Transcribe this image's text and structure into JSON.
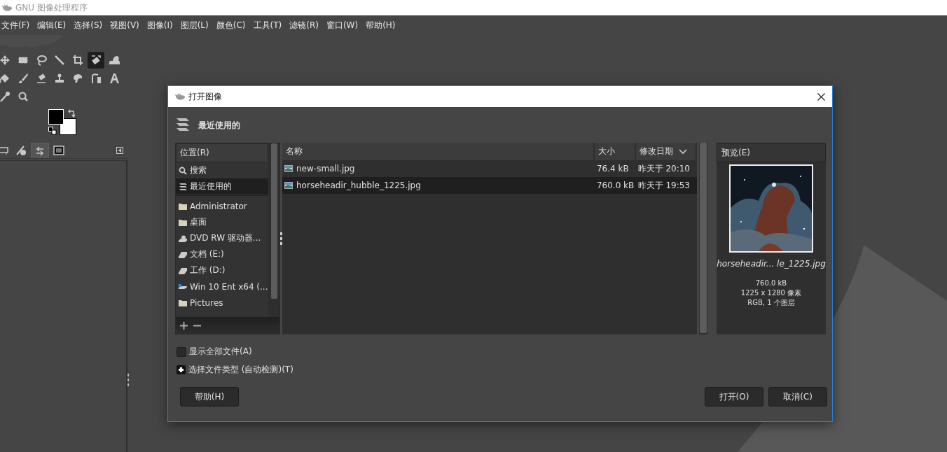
{
  "app": {
    "title": "GNU 图像处理程序"
  },
  "menu": [
    "文件(F)",
    "编辑(E)",
    "选择(S)",
    "视图(V)",
    "图像(I)",
    "图层(L)",
    "颜色(C)",
    "工具(T)",
    "滤镜(R)",
    "窗口(W)",
    "帮助(H)"
  ],
  "tools": [
    {
      "kind": "move",
      "selected": false
    },
    {
      "kind": "rect",
      "selected": false
    },
    {
      "kind": "lasso",
      "selected": false
    },
    {
      "kind": "wand",
      "selected": false
    },
    {
      "kind": "crop",
      "selected": false
    },
    {
      "kind": "transform",
      "selected": true
    },
    {
      "kind": "warp",
      "selected": false
    },
    {
      "kind": "bucket",
      "selected": false
    },
    {
      "kind": "brush",
      "selected": false
    },
    {
      "kind": "eraser",
      "selected": false
    },
    {
      "kind": "clone",
      "selected": false
    },
    {
      "kind": "smudge",
      "selected": false
    },
    {
      "kind": "paths",
      "selected": false
    },
    {
      "kind": "text",
      "selected": false
    },
    {
      "kind": "picker",
      "selected": false
    },
    {
      "kind": "zoom",
      "selected": false
    }
  ],
  "dock_tabs": [
    {
      "kind": "options",
      "selected": false
    },
    {
      "kind": "device",
      "selected": false
    },
    {
      "kind": "undo",
      "selected": true
    },
    {
      "kind": "images",
      "selected": false
    }
  ],
  "dialog": {
    "title": "打开图像",
    "location": "最近使用的",
    "places_header": "位置(R)",
    "places": [
      {
        "kind": "search",
        "label": "搜索",
        "selected": false
      },
      {
        "kind": "recent",
        "label": "最近使用的",
        "selected": true
      },
      {
        "kind": "folder",
        "label": "Administrator",
        "selected": false
      },
      {
        "kind": "folder",
        "label": "桌面",
        "selected": false
      },
      {
        "kind": "optical",
        "label": "DVD RW 驱动器...",
        "selected": false
      },
      {
        "kind": "drive",
        "label": "文档 (E:)",
        "selected": false
      },
      {
        "kind": "drive",
        "label": "工作 (D:)",
        "selected": false
      },
      {
        "kind": "system",
        "label": "Win 10 Ent x64 (...",
        "selected": false
      },
      {
        "kind": "folder",
        "label": "Pictures",
        "selected": false
      }
    ],
    "columns": [
      {
        "label": "名称",
        "sorted": false
      },
      {
        "label": "大小",
        "sorted": false
      },
      {
        "label": "修改日期",
        "sorted": true
      }
    ],
    "files": [
      {
        "name": "new-small.jpg",
        "size": "76.4 kB",
        "modified": "昨天于 20:10",
        "selected": false
      },
      {
        "name": "horseheadir_hubble_1225.jpg",
        "size": "760.0 kB",
        "modified": "昨天于 19:53",
        "selected": true
      }
    ],
    "preview": {
      "header": "预览(E)",
      "kind": "picture",
      "filename": "horseheadir... le_1225.jpg",
      "info": [
        "760.0 kB",
        "1225 x 1280 像素",
        "RGB, 1 个图层"
      ]
    },
    "show_all": {
      "label": "显示全部文件(A)",
      "checked": false
    },
    "file_type": {
      "label": "选择文件类型 (自动检测)(T)",
      "expanded": false
    },
    "buttons": [
      {
        "kind": "help",
        "label": "帮助(H)"
      },
      {
        "kind": "open",
        "label": "打开(O)"
      },
      {
        "kind": "cancel",
        "label": "取消(C)"
      }
    ]
  }
}
